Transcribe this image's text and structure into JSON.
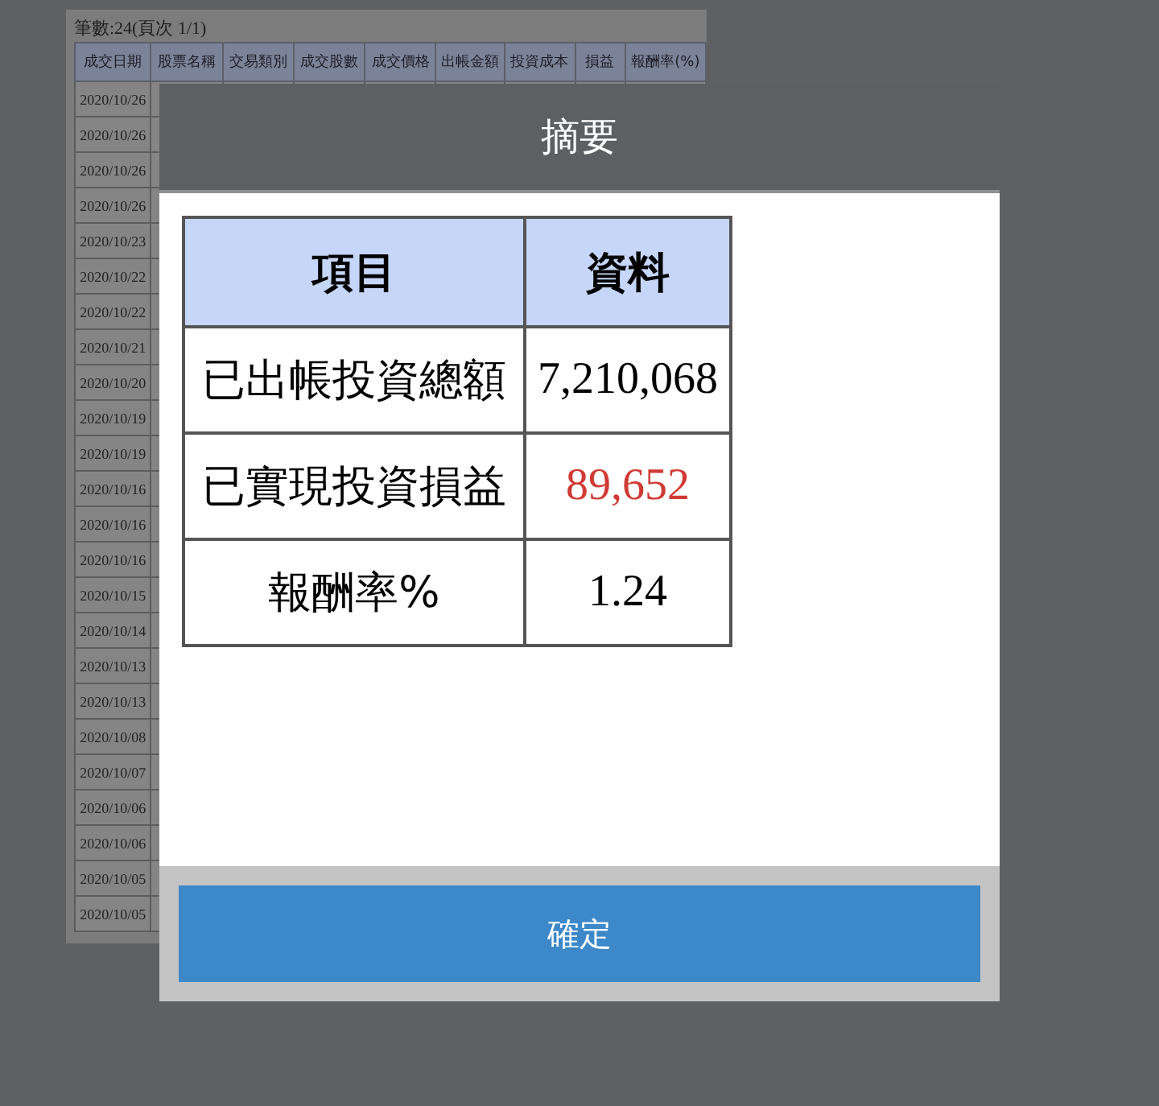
{
  "record_count": "筆數:24(頁次 1/1)",
  "table": {
    "columns": [
      "成交日期",
      "股票名稱",
      "交易類別",
      "成交股數",
      "成交價格",
      "出帳金額",
      "投資成本",
      "損益",
      "報酬率(%)"
    ],
    "rows": [
      "2020/10/26",
      "2020/10/26",
      "2020/10/26",
      "2020/10/26",
      "2020/10/23",
      "2020/10/22",
      "2020/10/22",
      "2020/10/21",
      "2020/10/20",
      "2020/10/19",
      "2020/10/19",
      "2020/10/16",
      "2020/10/16",
      "2020/10/16",
      "2020/10/15",
      "2020/10/14",
      "2020/10/13",
      "2020/10/13",
      "2020/10/08",
      "2020/10/07",
      "2020/10/06",
      "2020/10/06",
      "2020/10/05",
      "2020/10/05"
    ]
  },
  "dialog": {
    "title": "摘要",
    "summary": {
      "columns": [
        "項目",
        "資料"
      ],
      "rows": [
        {
          "label": "已出帳投資總額",
          "value": "7,210,068",
          "positive": false
        },
        {
          "label": "已實現投資損益",
          "value": "89,652",
          "positive": true
        },
        {
          "label": "報酬率%",
          "value": "1.24",
          "positive": false
        }
      ]
    },
    "confirm_button": "確定"
  }
}
